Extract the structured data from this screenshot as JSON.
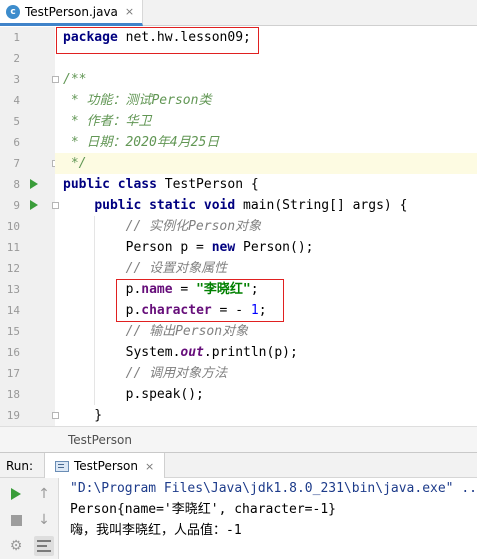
{
  "editor_tab": {
    "title": "TestPerson.java",
    "icon_letter": "c",
    "close_label": "×"
  },
  "code": {
    "lines": [
      {
        "num": "1",
        "tokens": [
          [
            "kw",
            "package"
          ],
          [
            "plain",
            " net.hw.lesson09;"
          ]
        ]
      },
      {
        "num": "2",
        "tokens": []
      },
      {
        "num": "3",
        "tokens": [
          [
            "doc",
            "/**"
          ]
        ]
      },
      {
        "num": "4",
        "tokens": [
          [
            "doc",
            " * 功能：测试Person类"
          ]
        ]
      },
      {
        "num": "5",
        "tokens": [
          [
            "doc",
            " * 作者：华卫"
          ]
        ]
      },
      {
        "num": "6",
        "tokens": [
          [
            "doc",
            " * 日期：2020年4月25日"
          ]
        ]
      },
      {
        "num": "7",
        "tokens": [
          [
            "doc",
            " */"
          ]
        ]
      },
      {
        "num": "8",
        "tokens": [
          [
            "kw",
            "public class "
          ],
          [
            "plain",
            "TestPerson {"
          ]
        ]
      },
      {
        "num": "9",
        "tokens": [
          [
            "plain",
            "    "
          ],
          [
            "kw",
            "public static void "
          ],
          [
            "plain",
            "main(String[] args) {"
          ]
        ]
      },
      {
        "num": "10",
        "tokens": [
          [
            "plain",
            "        "
          ],
          [
            "cm",
            "// 实例化Person对象"
          ]
        ]
      },
      {
        "num": "11",
        "tokens": [
          [
            "plain",
            "        Person p = "
          ],
          [
            "kw",
            "new "
          ],
          [
            "plain",
            "Person();"
          ]
        ]
      },
      {
        "num": "12",
        "tokens": [
          [
            "plain",
            "        "
          ],
          [
            "cm",
            "// 设置对象属性"
          ]
        ]
      },
      {
        "num": "13",
        "tokens": [
          [
            "plain",
            "        p."
          ],
          [
            "field",
            "name"
          ],
          [
            "plain",
            " = "
          ],
          [
            "str",
            "\"李晓红\""
          ],
          [
            "plain",
            ";"
          ]
        ]
      },
      {
        "num": "14",
        "tokens": [
          [
            "plain",
            "        p."
          ],
          [
            "field",
            "character"
          ],
          [
            "plain",
            " = - "
          ],
          [
            "num",
            "1"
          ],
          [
            "plain",
            ";"
          ]
        ]
      },
      {
        "num": "15",
        "tokens": [
          [
            "plain",
            "        "
          ],
          [
            "cm",
            "// 输出Person对象"
          ]
        ]
      },
      {
        "num": "16",
        "tokens": [
          [
            "plain",
            "        System."
          ],
          [
            "static",
            "out"
          ],
          [
            "plain",
            ".println(p);"
          ]
        ]
      },
      {
        "num": "17",
        "tokens": [
          [
            "plain",
            "        "
          ],
          [
            "cm",
            "// 调用对象方法"
          ]
        ]
      },
      {
        "num": "18",
        "tokens": [
          [
            "plain",
            "        p.speak();"
          ]
        ]
      },
      {
        "num": "19",
        "tokens": [
          [
            "plain",
            "    }"
          ]
        ]
      }
    ],
    "highlighted_line": "7",
    "run_markers": [
      "8",
      "9"
    ]
  },
  "breadcrumb": {
    "text": "TestPerson"
  },
  "run_panel": {
    "label": "Run:",
    "tab_title": "TestPerson",
    "tab_close": "×",
    "console_lines": [
      "\"D:\\Program Files\\Java\\jdk1.8.0_231\\bin\\java.exe\" ...",
      "Person{name='李晓红', character=-1}",
      "嗨，我叫李晓红，人品值：-1"
    ]
  },
  "colors": {
    "keyword": "#000080",
    "field": "#660e7a",
    "string": "#008000",
    "number": "#0000ff",
    "doc_comment": "#629755",
    "comment": "#808080",
    "annotation_box": "#e02020",
    "run_green": "#3a9d3a"
  }
}
